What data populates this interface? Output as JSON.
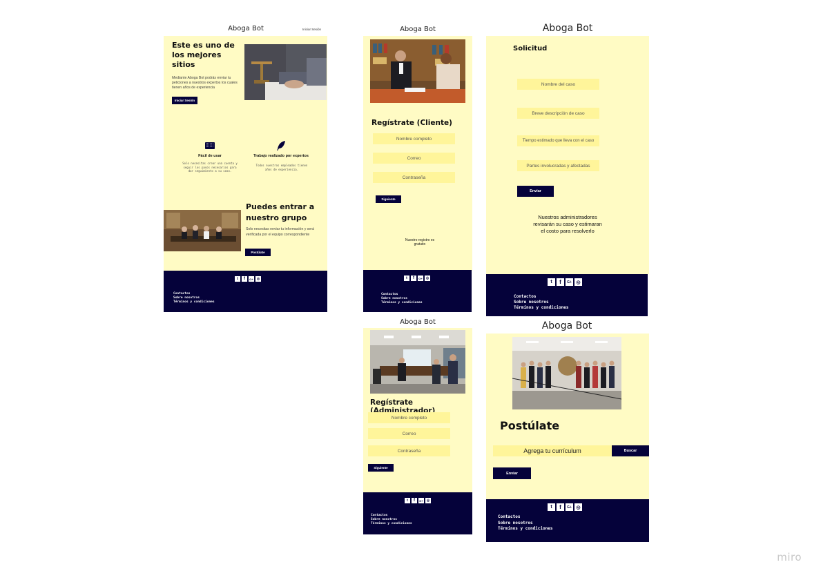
{
  "brand": "Aboga Bot",
  "home": {
    "title": "Aboga Bot",
    "login_link": "Iniciar Sesión",
    "hero_heading": "Este es uno de los mejores sitios",
    "hero_text": "Mediante Aboga Bot podrás enviar tu peticiones a nuestros expertos los cuales tienen años de experiencia",
    "hero_button": "Iniciar Sesión",
    "feature1_title": "Fácil de usar",
    "feature1_text": "Solo necesitas crear una cuenta y seguir los pasos necesarios para dar seguimiento a su caso.",
    "feature2_title": "Trabajo realizado por expertos",
    "feature2_text": "Todos nuestros empleados tienen años de experiencia.",
    "group_heading": "Puedes entrar a nuestro grupo",
    "group_text": "Solo necesitas enviar tu información y será verificada por el equipo correspondiente",
    "group_button": "Postúlate"
  },
  "client_register": {
    "title": "Aboga Bot",
    "heading": "Regístrate (Cliente)",
    "name_placeholder": "Nombre completo",
    "email_placeholder": "Correo",
    "password_placeholder": "Contraseña",
    "next_button": "Siguiente",
    "note": "Nuestro registro es gratuito"
  },
  "request": {
    "title": "Aboga Bot",
    "heading": "Solicitud",
    "field1": "Nombre del caso",
    "field2": "Breve descripción de caso",
    "field3": "Tiempo estimado que lleva con el caso",
    "field4": "Partes involucradas y afectadas",
    "send_button": "Enviar",
    "note": "Nuestros administradores revisarán su caso y estimaran el costo para resolverlo"
  },
  "admin_register": {
    "title": "Aboga Bot",
    "heading": "Regístrate (Administrador)",
    "name_placeholder": "Nombre completo",
    "email_placeholder": "Correo",
    "password_placeholder": "Contraseña",
    "next_button": "Siguiente"
  },
  "apply": {
    "title": "Aboga Bot",
    "heading": "Postúlate",
    "cv_placeholder": "Agrega tu currículum",
    "search_button": "Buscar",
    "send_button": "Enviar"
  },
  "footer": {
    "contacts": "Contactos",
    "about": "Sobre nosotros",
    "terms": "Términos y condiciones",
    "social_icons": [
      "twitter-icon",
      "facebook-icon",
      "google-plus-icon",
      "instagram-icon"
    ]
  },
  "watermark": "miro",
  "colors": {
    "frame_bg": "#fffbc4",
    "field_bg": "#fff59a",
    "navy": "#05023a"
  }
}
